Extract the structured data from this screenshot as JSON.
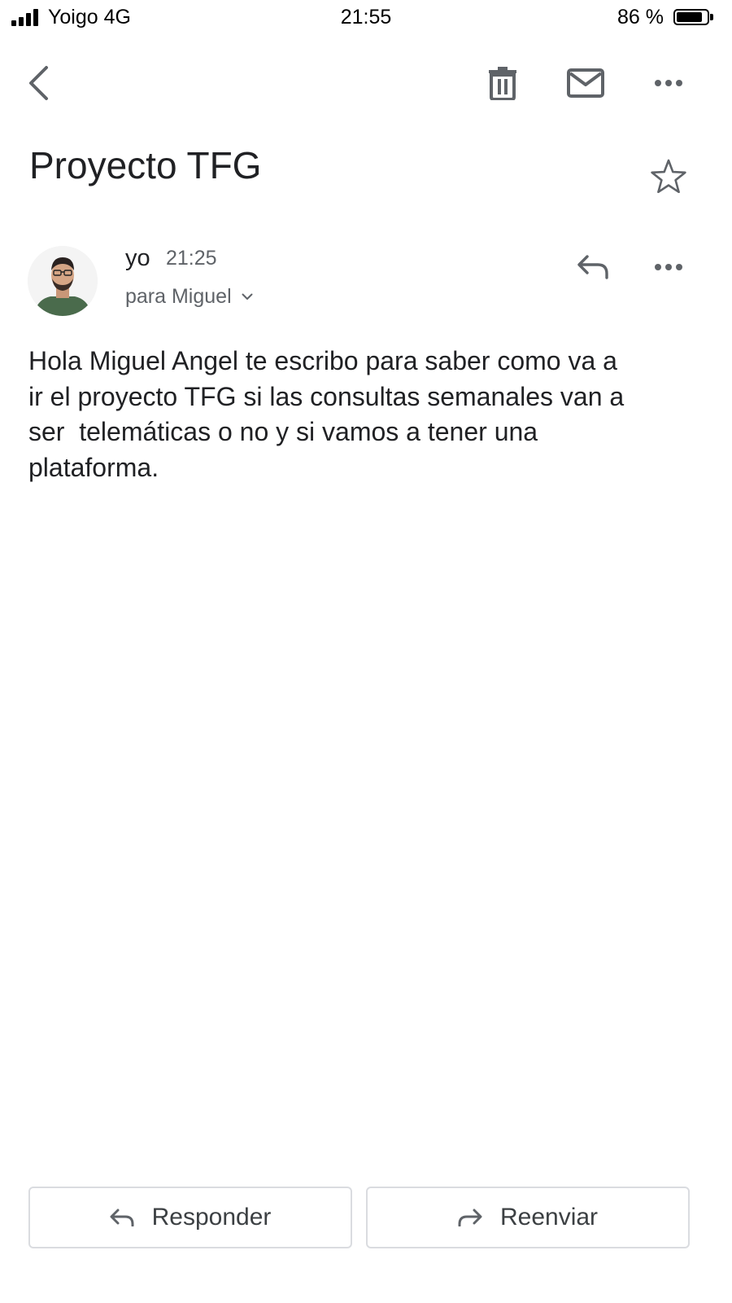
{
  "status_bar": {
    "carrier": "Yoigo 4G",
    "time": "21:55",
    "battery_text": "86 %",
    "battery_level": 0.86,
    "signal_bars": 4
  },
  "app_bar": {
    "back_icon": "chevron-left-icon",
    "delete_icon": "trash-icon",
    "mark_unread_icon": "mail-icon",
    "more_icon": "more-horizontal-icon"
  },
  "email": {
    "subject": "Proyecto TFG",
    "star_icon": "star-outline-icon",
    "sender": "yo",
    "time": "21:25",
    "recipient": "para Miguel",
    "body": "Hola Miguel Angel te escribo para saber como va a\nir el proyecto TFG si las consultas semanales van a\nser  telemáticas o no y si vamos a tener una\nplataforma."
  },
  "actions": {
    "reply_label": "Responder",
    "forward_label": "Reenviar"
  },
  "colors": {
    "text": "#202124",
    "secondary_text": "#5f6368",
    "icon": "#5f6368",
    "button_border": "#dadce0"
  }
}
